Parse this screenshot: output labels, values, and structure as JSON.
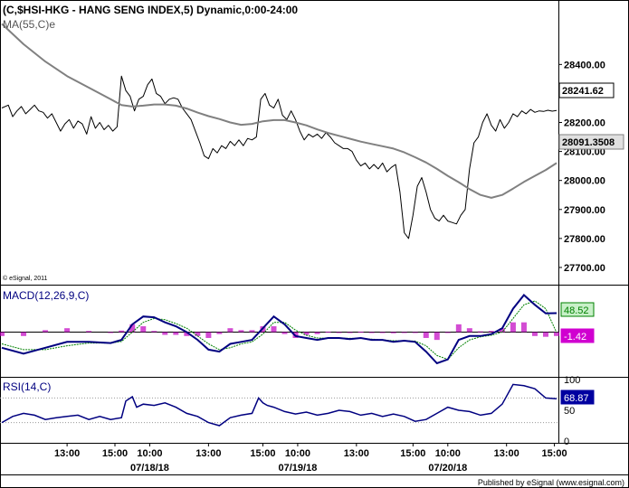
{
  "chart_data": {
    "type": "line",
    "title": "(C,$HSI-HKG - HANG SENG INDEX,5) Dynamic,0:00-24:00",
    "price_panel": {
      "ma_label": "MA(55,C)e",
      "copyright": "© eSignal, 2011",
      "ylim": [
        27650,
        28560
      ],
      "y_ticks": [
        "28400.00",
        "28300.00",
        "28200.00",
        "28100.00",
        "28000.00",
        "27900.00",
        "27800.00",
        "27700.00"
      ],
      "y_tick_values": [
        28400,
        28300,
        28200,
        28100,
        28000,
        27900,
        27800,
        27700
      ],
      "last_price_label": "28241.62",
      "last_price": 28241.62,
      "ma_last_label": "28091.3508",
      "ma_last": 28091.35,
      "series": [
        {
          "name": "Close",
          "color": "#000000",
          "x": [
            0,
            3,
            5,
            7,
            9,
            11,
            13,
            15,
            17,
            19,
            21,
            23,
            25,
            27,
            29,
            31,
            33,
            35,
            37,
            39,
            41,
            43,
            45,
            47,
            49,
            51,
            53,
            55,
            57,
            59,
            61,
            63,
            65,
            67,
            69,
            71,
            73,
            75,
            77,
            79,
            81,
            83,
            85,
            87,
            89,
            91,
            93,
            95,
            97,
            99,
            101,
            103,
            105,
            107,
            109,
            111,
            113,
            115,
            117,
            119,
            121,
            123,
            125,
            127,
            129,
            131,
            133,
            135,
            137,
            139,
            141,
            143,
            145,
            147,
            149,
            151,
            153,
            155,
            157,
            159,
            161,
            163,
            165,
            167,
            169,
            171,
            173,
            175,
            177,
            179,
            181,
            183,
            185,
            187,
            189,
            191,
            193,
            195,
            197,
            199,
            201,
            203,
            205,
            207,
            209,
            211,
            213,
            215,
            217,
            219,
            221,
            223,
            225,
            227,
            229,
            231,
            233,
            235,
            237,
            239,
            241,
            243,
            245,
            247,
            249,
            251,
            253,
            255
          ],
          "y": [
            28250,
            28260,
            28220,
            28240,
            28255,
            28230,
            28245,
            28260,
            28240,
            28235,
            28215,
            28230,
            28200,
            28170,
            28195,
            28210,
            28180,
            28205,
            28195,
            28160,
            28220,
            28180,
            28200,
            28175,
            28190,
            28170,
            28185,
            28360,
            28310,
            28290,
            28240,
            28280,
            28290,
            28330,
            28350,
            28300,
            28290,
            28265,
            28280,
            28285,
            28280,
            28250,
            28230,
            28210,
            28170,
            28130,
            28085,
            28075,
            28110,
            28095,
            28120,
            28110,
            28135,
            28120,
            28140,
            28120,
            28145,
            28140,
            28150,
            28280,
            28300,
            28260,
            28250,
            28280,
            28225,
            28210,
            28240,
            28210,
            28170,
            28140,
            28160,
            28150,
            28160,
            28145,
            28165,
            28150,
            28130,
            28120,
            28110,
            28110,
            28100,
            28070,
            28050,
            28060,
            28040,
            28055,
            28040,
            28060,
            28030,
            28045,
            28055,
            27960,
            27820,
            27800,
            27880,
            27980,
            28010,
            27960,
            27900,
            27870,
            27860,
            27880,
            27860,
            27855,
            27850,
            27880,
            27900,
            28040,
            28130,
            28150,
            28200,
            28230,
            28190,
            28170,
            28210,
            28180,
            28200,
            28230,
            28220,
            28240,
            28230,
            28245,
            28235,
            28240,
            28238,
            28242,
            28239,
            28241.62
          ],
          "x_scaled": true
        },
        {
          "name": "MA(55,C)e",
          "color": "#808080",
          "x": [
            0,
            10,
            20,
            30,
            40,
            50,
            55,
            60,
            65,
            70,
            75,
            80,
            85,
            90,
            95,
            100,
            105,
            110,
            115,
            120,
            125,
            130,
            135,
            140,
            145,
            150,
            155,
            160,
            165,
            170,
            175,
            180,
            185,
            190,
            195,
            200,
            205,
            210,
            215,
            220,
            225,
            230,
            235,
            240,
            245,
            250,
            255
          ],
          "y": [
            28540,
            28470,
            28410,
            28360,
            28320,
            28280,
            28260,
            28255,
            28258,
            28262,
            28262,
            28258,
            28248,
            28234,
            28222,
            28212,
            28200,
            28192,
            28195,
            28204,
            28208,
            28208,
            28200,
            28190,
            28176,
            28164,
            28154,
            28144,
            28134,
            28126,
            28118,
            28110,
            28097,
            28080,
            28062,
            28040,
            28016,
            27994,
            27970,
            27950,
            27940,
            27950,
            27972,
            27995,
            28016,
            28036,
            28060
          ]
        }
      ]
    },
    "macd_panel": {
      "label": "MACD(12,26,9,C)",
      "macd_value_label": "48.52",
      "signal_value_label": "-1.42",
      "ylim": [
        -110,
        110
      ],
      "zero_line": 0,
      "macd_color": "#000080",
      "signal_color": "#008000",
      "hist_color": "#c000c0",
      "x": [
        0,
        10,
        20,
        30,
        40,
        50,
        55,
        60,
        65,
        70,
        75,
        80,
        85,
        90,
        95,
        100,
        105,
        110,
        115,
        120,
        125,
        130,
        135,
        140,
        145,
        150,
        155,
        160,
        165,
        170,
        175,
        180,
        185,
        190,
        195,
        200,
        205,
        210,
        215,
        220,
        225,
        230,
        235,
        240,
        245,
        250,
        255
      ],
      "macd": [
        -40,
        -55,
        -40,
        -25,
        -25,
        -28,
        -20,
        20,
        40,
        38,
        25,
        15,
        0,
        -20,
        -45,
        -50,
        -30,
        -25,
        -20,
        10,
        40,
        20,
        -10,
        -15,
        -20,
        -15,
        -15,
        -18,
        -15,
        -20,
        -20,
        -25,
        -22,
        -25,
        -50,
        -80,
        -70,
        -20,
        -10,
        -10,
        -5,
        10,
        60,
        95,
        70,
        48,
        48.52
      ],
      "signal": [
        -30,
        -45,
        -45,
        -35,
        -28,
        -28,
        -24,
        0,
        25,
        35,
        32,
        22,
        10,
        -10,
        -30,
        -45,
        -40,
        -30,
        -25,
        -5,
        25,
        25,
        5,
        -8,
        -15,
        -16,
        -15,
        -16,
        -16,
        -18,
        -20,
        -22,
        -22,
        -23,
        -35,
        -60,
        -70,
        -40,
        -20,
        -12,
        -8,
        0,
        35,
        70,
        80,
        60,
        -1.42
      ],
      "hist": [
        -10,
        -10,
        5,
        10,
        3,
        0,
        4,
        20,
        15,
        3,
        -7,
        -7,
        -10,
        -10,
        -15,
        -5,
        10,
        5,
        5,
        15,
        15,
        -5,
        -15,
        -7,
        -5,
        1,
        0,
        -2,
        1,
        -2,
        0,
        -3,
        0,
        -2,
        -15,
        -20,
        0,
        20,
        10,
        2,
        3,
        10,
        25,
        25,
        -10,
        -12,
        -10
      ]
    },
    "rsi_panel": {
      "label": "RSI(14,C)",
      "value_label": "68.87",
      "ylim": [
        0,
        100
      ],
      "y_ticks": [
        "100",
        "50",
        "0"
      ],
      "y_tick_values": [
        100,
        50,
        0
      ],
      "guide_levels": [
        70,
        30
      ],
      "color": "#000080",
      "x": [
        0,
        5,
        10,
        15,
        20,
        25,
        30,
        35,
        40,
        45,
        50,
        55,
        57,
        60,
        62,
        65,
        70,
        75,
        80,
        85,
        90,
        95,
        100,
        105,
        110,
        115,
        118,
        120,
        122,
        125,
        130,
        135,
        140,
        145,
        150,
        155,
        160,
        165,
        170,
        175,
        180,
        185,
        190,
        195,
        200,
        205,
        210,
        215,
        220,
        225,
        230,
        235,
        240,
        245,
        250,
        255
      ],
      "y": [
        30,
        40,
        45,
        42,
        35,
        38,
        40,
        42,
        35,
        40,
        35,
        38,
        65,
        72,
        55,
        60,
        58,
        62,
        55,
        45,
        40,
        30,
        25,
        38,
        42,
        45,
        70,
        62,
        58,
        55,
        48,
        44,
        47,
        42,
        45,
        50,
        48,
        42,
        45,
        40,
        44,
        40,
        32,
        35,
        45,
        55,
        50,
        48,
        42,
        45,
        60,
        92,
        90,
        85,
        70,
        68.87
      ]
    },
    "x_axis": {
      "time_labels": [
        "13:00",
        "15:00",
        "10:00",
        "13:00",
        "15:00",
        "10:00",
        "13:00",
        "15:00",
        "10:00",
        "13:00",
        "15:00"
      ],
      "time_label_x": [
        30,
        52,
        68,
        95,
        120,
        136,
        163,
        189,
        205,
        232,
        254
      ],
      "date_labels": [
        "07/18/18",
        "07/19/18",
        "07/20/18"
      ],
      "date_label_x": [
        68,
        136,
        205
      ]
    }
  },
  "footer": "Published by eSignal (www.esignal.com)"
}
